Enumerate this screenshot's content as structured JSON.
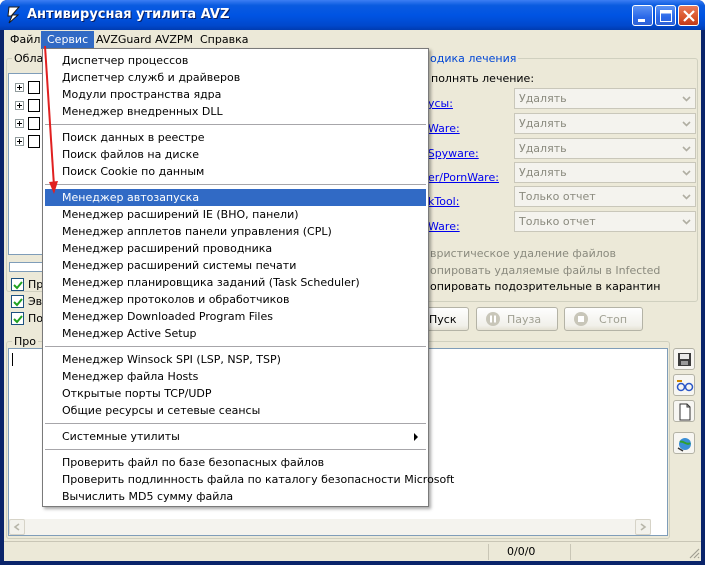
{
  "window": {
    "title": "Антивирусная утилита AVZ"
  },
  "menubar": [
    {
      "label": "Файл"
    },
    {
      "label": "Сервис"
    },
    {
      "label": "AVZGuard"
    },
    {
      "label": "AVZPM"
    },
    {
      "label": "Справка"
    }
  ],
  "scan_area": {
    "title": "Обла"
  },
  "method": {
    "title": "одика лечения",
    "perform": "полнять лечение:",
    "rows": [
      {
        "label": "усы:",
        "value": "Удалять"
      },
      {
        "label": "Ware:",
        "value": "Удалять"
      },
      {
        "label": "/Spyware:",
        "value": "Удалять"
      },
      {
        "label": "er/PornWare:",
        "value": "Удалять"
      },
      {
        "label": "kTool:",
        "value": "Только отчет"
      },
      {
        "label": "Ware:",
        "value": "Только отчет"
      }
    ],
    "heuristic": "вристическое удаление файлов",
    "copy_infected": "опировать удаляемые файлы в  Infected",
    "copy_suspicious": "опировать подозрительные в  карантин"
  },
  "left_checks": [
    {
      "label": "Пр"
    },
    {
      "label": "Эв"
    },
    {
      "label": "По"
    }
  ],
  "buttons": {
    "start": "Пуск",
    "pause": "Пауза",
    "stop": "Стоп"
  },
  "log_section": {
    "title": "Про"
  },
  "status": {
    "counter": "0/0/0"
  },
  "service_menu": {
    "items": [
      {
        "label": "Диспетчер процессов"
      },
      {
        "label": "Диспетчер служб и драйверов"
      },
      {
        "label": "Модули пространства ядра"
      },
      {
        "label": "Менеджер внедренных DLL"
      },
      {
        "label": "Поиск данных  в реестре"
      },
      {
        "label": "Поиск файлов на диске"
      },
      {
        "label": "Поиск Cookie по данным"
      },
      {
        "label": "Менеджер автозапуска"
      },
      {
        "label": "Менеджер расширений IE (BHO, панели)"
      },
      {
        "label": "Менеджер апплетов панели управления (CPL)"
      },
      {
        "label": "Менеджер расширений проводника"
      },
      {
        "label": "Менеджер расширений системы печати"
      },
      {
        "label": "Менеджер планировщика заданий (Task Scheduler)"
      },
      {
        "label": "Менеджер протоколов и обработчиков"
      },
      {
        "label": "Менеджер Downloaded Program Files"
      },
      {
        "label": "Менеджер Active Setup"
      },
      {
        "label": "Менеджер Winsock SPI (LSP, NSP, TSP)"
      },
      {
        "label": "Менеджер файла Hosts"
      },
      {
        "label": "Открытые порты TCP/UDP"
      },
      {
        "label": "Общие ресурсы и сетевые сеансы"
      },
      {
        "label": "Системные утилиты"
      },
      {
        "label": "Проверить файл по базе безопасных файлов"
      },
      {
        "label": "Проверить подлинность файла по каталогу безопасности Microsoft"
      },
      {
        "label": "Вычислить MD5 сумму файла"
      }
    ]
  },
  "colors": {
    "title_blue": "#0054e3",
    "highlight": "#316ac5",
    "annotation_arrow": "#e02020"
  }
}
